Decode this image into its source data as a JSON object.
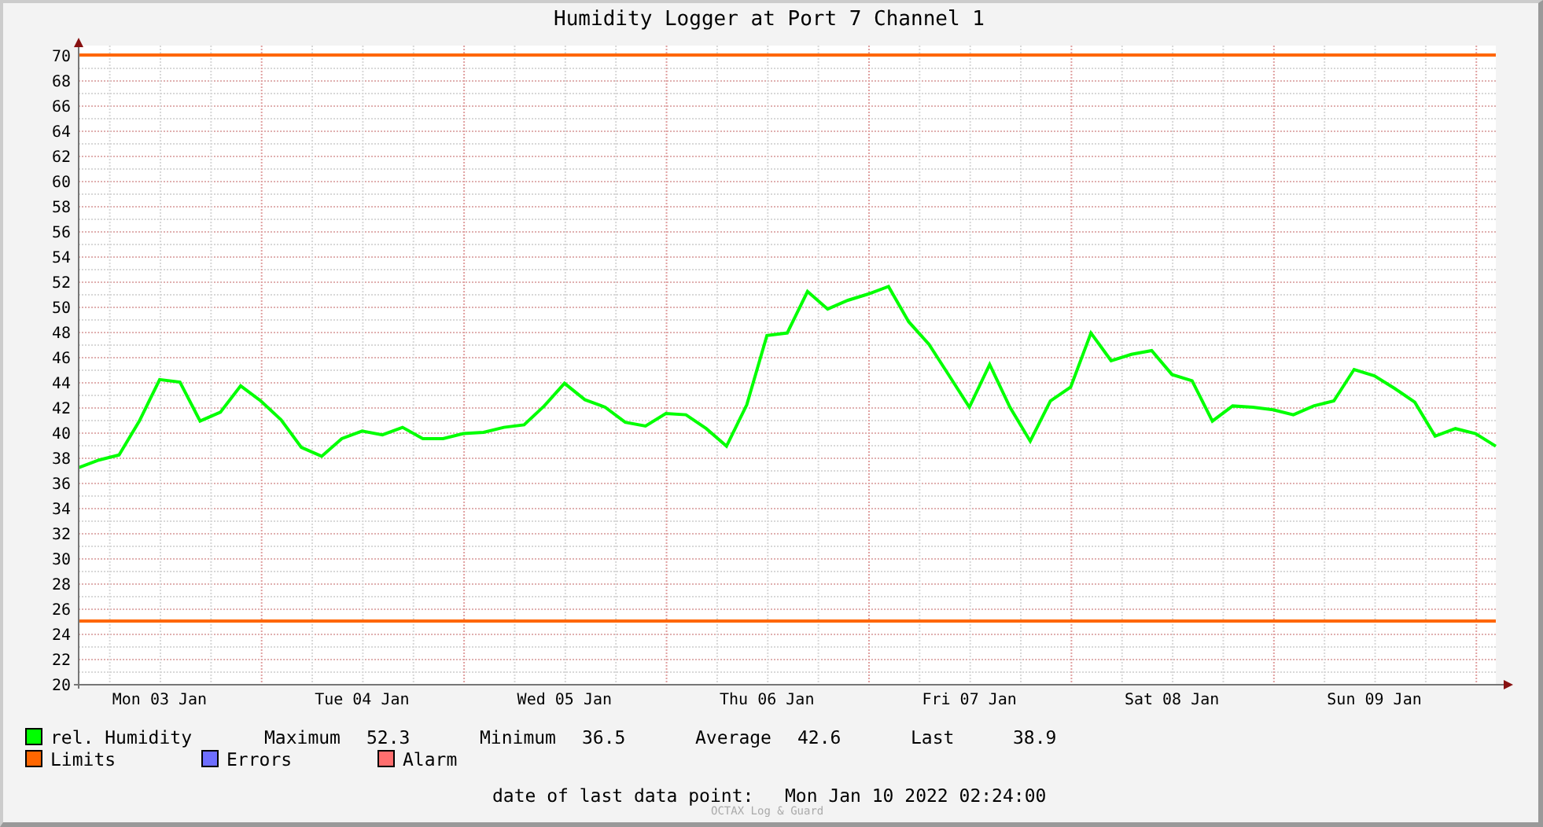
{
  "title": "Humidity Logger at Port 7 Channel 1",
  "chart_data": {
    "type": "line",
    "ylim": [
      20,
      70
    ],
    "yticks": [
      20,
      22,
      24,
      26,
      28,
      30,
      32,
      34,
      36,
      38,
      40,
      42,
      44,
      46,
      48,
      50,
      52,
      54,
      56,
      58,
      60,
      62,
      64,
      66,
      68,
      70
    ],
    "categories": [
      null,
      null,
      null,
      null,
      "Mon 03 Jan",
      null,
      null,
      null,
      null,
      null,
      null,
      null,
      null,
      null,
      "Tue 04 Jan",
      null,
      null,
      null,
      null,
      null,
      null,
      null,
      null,
      null,
      "Wed 05 Jan",
      null,
      null,
      null,
      null,
      null,
      null,
      null,
      null,
      null,
      "Thu 06 Jan",
      null,
      null,
      null,
      null,
      null,
      null,
      null,
      null,
      null,
      "Fri 07 Jan",
      null,
      null,
      null,
      null,
      null,
      null,
      null,
      null,
      null,
      "Sat 08 Jan",
      null,
      null,
      null,
      null,
      null,
      null,
      null,
      null,
      null,
      "Sun 09 Jan",
      null,
      null,
      null,
      null,
      null,
      null
    ],
    "series": [
      {
        "name": "rel. Humidity",
        "color": "#00ff00",
        "values": [
          37.2,
          37.8,
          38.2,
          40.9,
          44.2,
          44,
          40.9,
          41.6,
          43.7,
          42.5,
          41,
          38.8,
          38.1,
          39.5,
          40.1,
          39.8,
          40.4,
          39.5,
          39.5,
          39.9,
          40,
          40.4,
          40.6,
          42.1,
          43.9,
          42.6,
          42,
          40.8,
          40.5,
          41.5,
          41.4,
          40.3,
          38.9,
          42.2,
          47.7,
          47.9,
          51.2,
          49.8,
          50.5,
          51,
          51.6,
          48.8,
          47,
          44.5,
          42,
          45.4,
          42,
          39.3,
          42.5,
          43.6,
          47.9,
          45.7,
          46.2,
          46.5,
          44.6,
          44.1,
          40.9,
          42.1,
          42,
          41.8,
          41.4,
          42.1,
          42.5,
          45,
          44.5,
          43.5,
          42.4,
          39.7,
          40.3,
          39.9,
          38.9
        ]
      }
    ],
    "grid": true,
    "ref_lines": [
      {
        "axis": "y",
        "value": 70
      },
      {
        "axis": "y",
        "value": 25
      }
    ]
  },
  "legend": [
    {
      "kind": "series",
      "stats": [
        {
          "label": "Maximum",
          "value": "52.3"
        },
        {
          "label": "Minimum",
          "value": "36.5"
        },
        {
          "label": "Average",
          "value": "42.6"
        },
        {
          "label": "Last",
          "value": "38.9"
        }
      ]
    },
    {
      "kind": "plain",
      "label": "Limits",
      "color": "#ff6600"
    },
    {
      "kind": "plain",
      "label": "Errors",
      "color": "#6e6eff"
    },
    {
      "kind": "plain",
      "label": "Alarm",
      "color": "#ff6e6e"
    }
  ],
  "footer": {
    "label": "date of last data point:",
    "value": "Mon Jan 10 2022 02:24:00"
  },
  "credit": "OCTAX Log & Guard"
}
